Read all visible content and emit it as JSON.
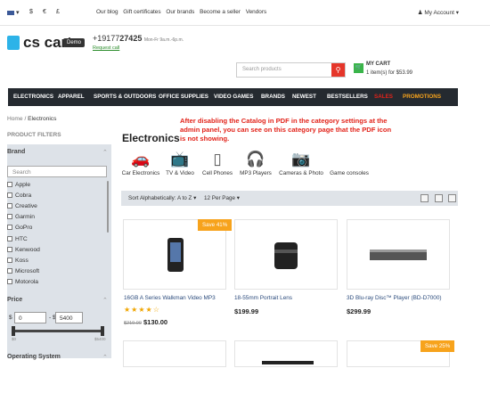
{
  "topbar": {
    "currency_usd": "$",
    "currency_eur": "€",
    "currency_gbp": "£",
    "links": [
      "Our blog",
      "Gift certificates",
      "Our brands",
      "Become a seller",
      "Vendors"
    ],
    "account": "My Account ▾"
  },
  "header": {
    "logo": "cs cart",
    "demo_badge": "Demo",
    "phone_prefix": "+19177",
    "phone_bold": "27425",
    "hours": "Mon-Fr 9a.m.-6p.m.",
    "request_call": "Request call",
    "search_placeholder": "Search products",
    "cart_title": "MY CART",
    "cart_summary": "1 item(s) for $53.99"
  },
  "nav": [
    "ELECTRONICS",
    "APPAREL",
    "SPORTS & OUTDOORS",
    "OFFICE SUPPLIES",
    "VIDEO GAMES",
    "BRANDS",
    "NEWEST",
    "BESTSELLERS",
    "SALES",
    "PROMOTIONS"
  ],
  "breadcrumb": {
    "home": "Home",
    "sep": "/",
    "current": "Electronics"
  },
  "filters": {
    "heading": "PRODUCT FILTERS",
    "brand_title": "Brand",
    "brand_search": "Search",
    "brands": [
      "Apple",
      "Cobra",
      "Creative",
      "Garmin",
      "GoPro",
      "HTC",
      "Kenwood",
      "Koss",
      "Microsoft",
      "Motorola"
    ],
    "price_title": "Price",
    "price_from_cur": "$",
    "price_from": "0",
    "price_sep": "- $",
    "price_to": "5400",
    "range_min": "$0",
    "range_max": "$5400",
    "os_title": "Operating System"
  },
  "category": {
    "title": "Electronics",
    "notice": "After disabling the Catalog in PDF in the category settings at the admin panel, you can see on this category page that the PDF icon is not showing.",
    "subcategories": [
      "Car Electronics",
      "TV & Video",
      "Cell Phones",
      "MP3 Players",
      "Cameras & Photo",
      "Game consoles"
    ]
  },
  "sort": {
    "sort_label": "Sort Alphabetically: A to Z ▾",
    "per_page": "12 Per Page ▾"
  },
  "products": [
    {
      "name": "16GB A Series Walkman Video MP3",
      "old_price": "$219.00",
      "price": "$130.00",
      "badge": "Save 41%",
      "stars": "★★★★☆"
    },
    {
      "name": "18-55mm Portrait Lens",
      "price": "$199.99"
    },
    {
      "name": "3D Blu-ray Disc™ Player (BD-D7000)",
      "price": "$299.99"
    }
  ],
  "row2_badge": "Save 25%",
  "colors": {
    "nav_bg": "#252a30",
    "sales": "#e2231a",
    "promotions": "#f7a31c",
    "accent": "#2db3e8",
    "save_badge": "#f7a31c",
    "notice": "#e2231a"
  }
}
